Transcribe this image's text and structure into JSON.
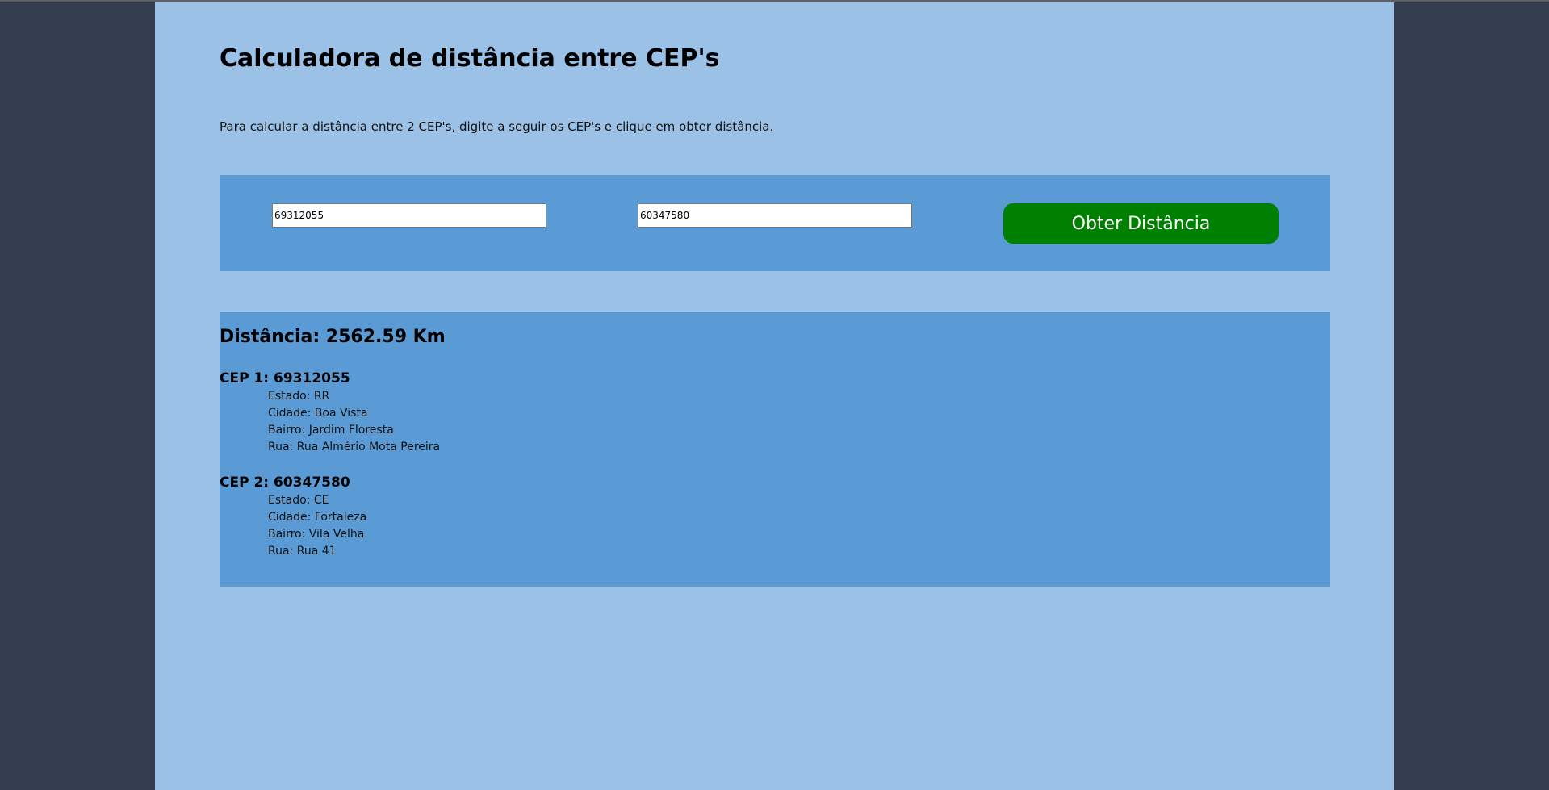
{
  "page": {
    "title": "Calculadora de distância entre CEP's",
    "instructions": "Para calcular a distância entre 2 CEP's, digite a seguir os CEP's e clique em obter distância."
  },
  "form": {
    "cep1_value": "69312055",
    "cep2_value": "60347580",
    "submit_label": "Obter Distância"
  },
  "result": {
    "distance": "Distância: 2562.59 Km",
    "cep1": {
      "heading": "CEP 1: 69312055",
      "estado": "Estado: RR",
      "cidade": "Cidade: Boa Vista",
      "bairro": "Bairro: Jardim Floresta",
      "rua": "Rua: Rua Almério Mota Pereira"
    },
    "cep2": {
      "heading": "CEP 2: 60347580",
      "estado": "Estado: CE",
      "cidade": "Cidade: Fortaleza",
      "bairro": "Bairro: Vila Velha",
      "rua": "Rua: Rua 41"
    }
  },
  "colors": {
    "outer_background": "#343d4e",
    "page_background": "#9bc2e6",
    "panel_background": "#5b9bd5",
    "button_background": "#008000",
    "button_text": "#ffffff"
  }
}
